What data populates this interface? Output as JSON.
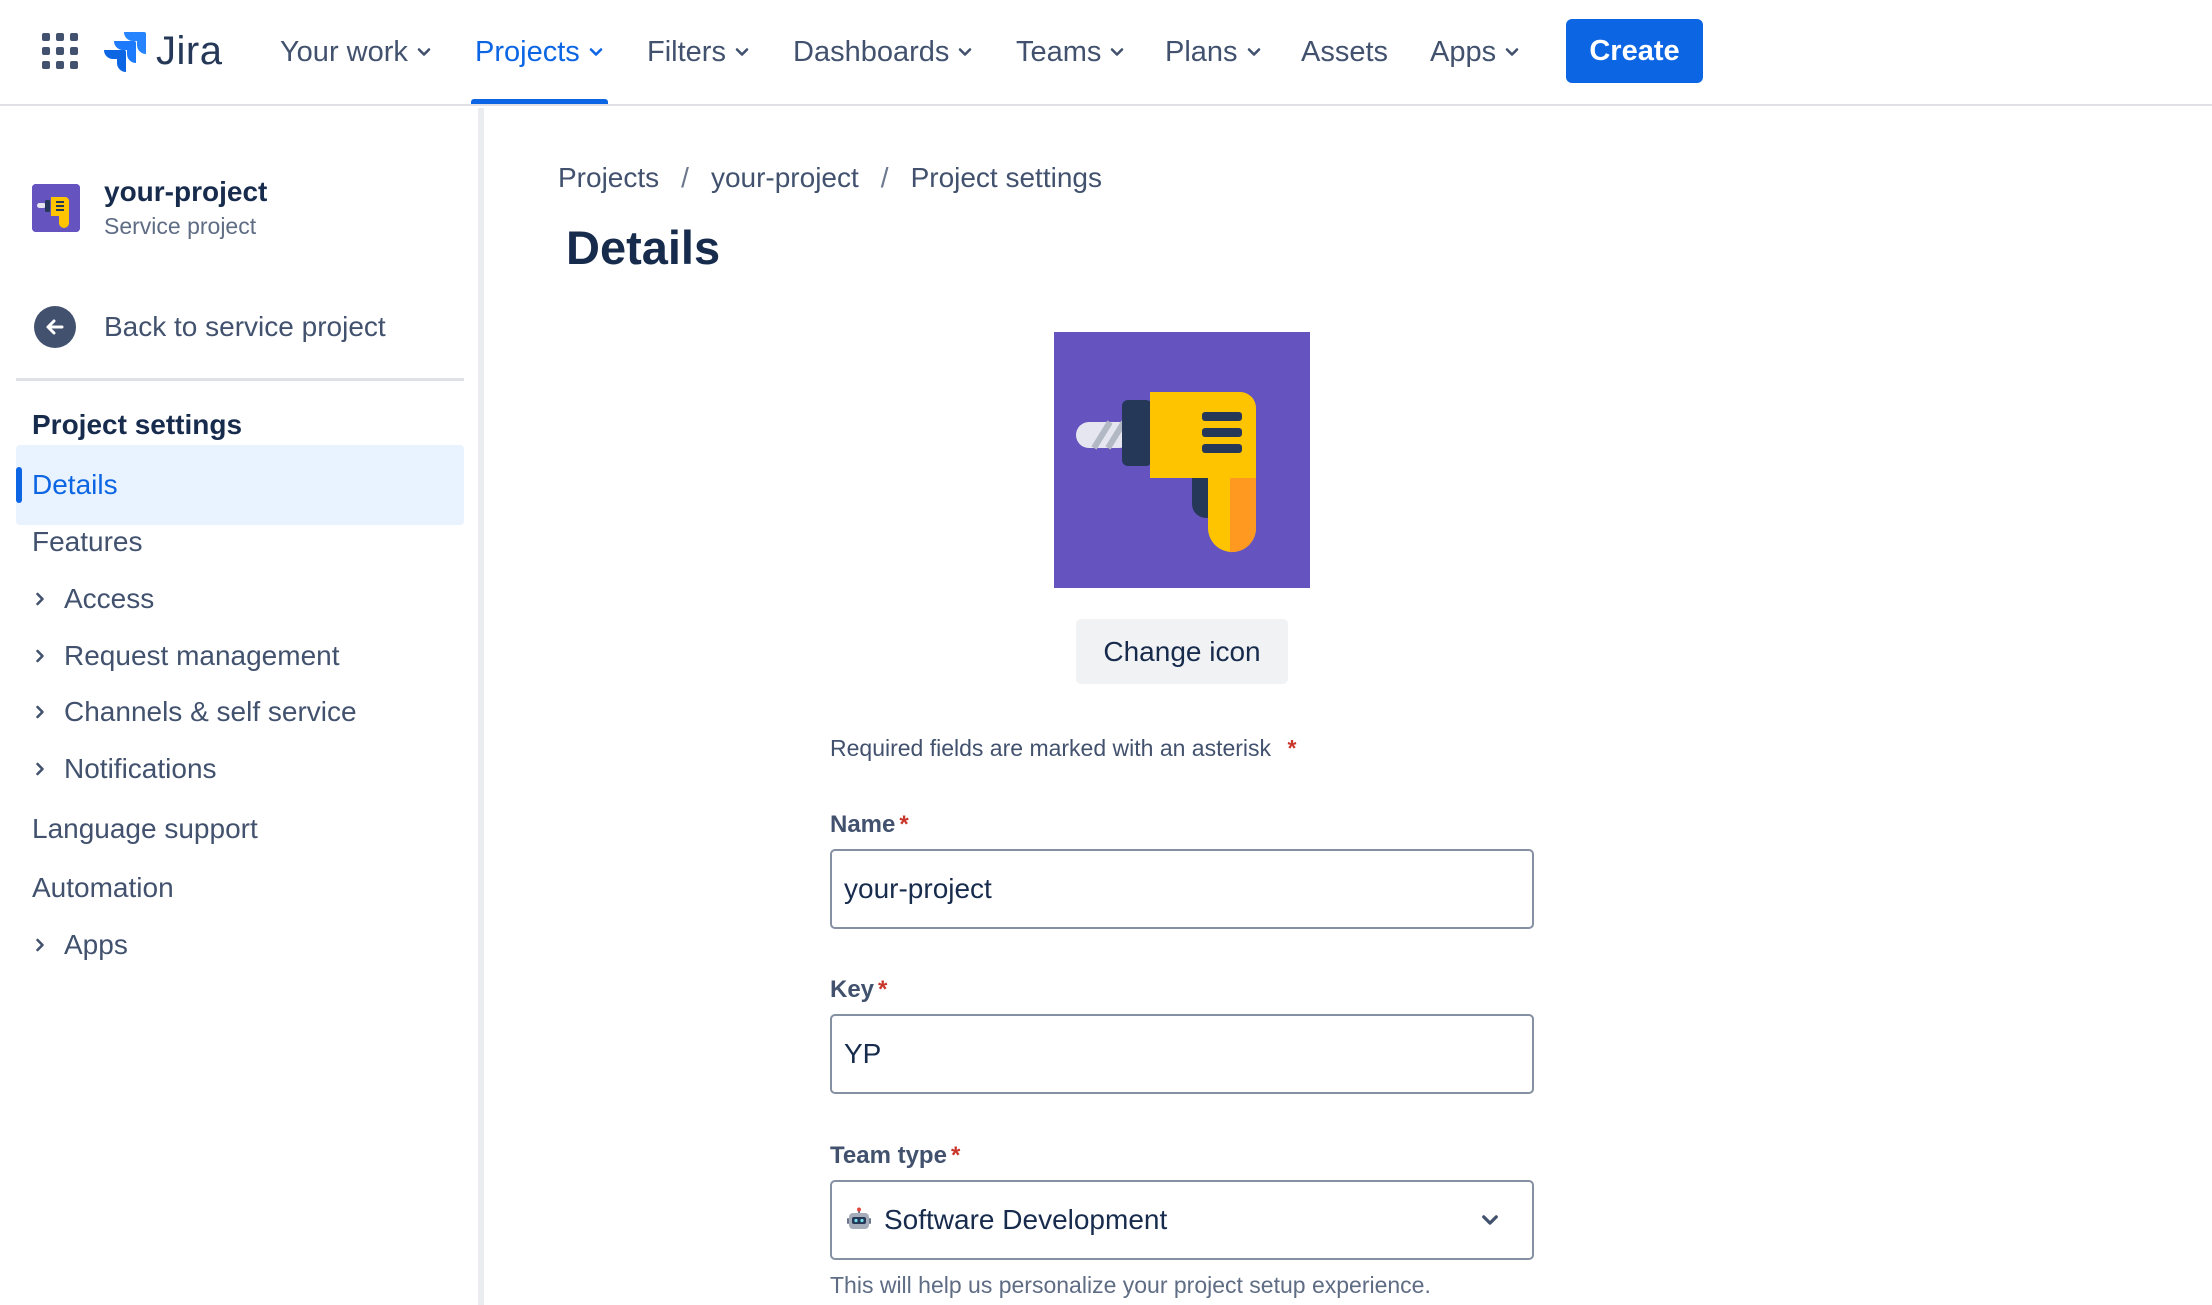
{
  "topnav": {
    "logo_text": "Jira",
    "items": [
      {
        "label": "Your work",
        "has_chevron": true
      },
      {
        "label": "Projects",
        "has_chevron": true,
        "active": true
      },
      {
        "label": "Filters",
        "has_chevron": true
      },
      {
        "label": "Dashboards",
        "has_chevron": true
      },
      {
        "label": "Teams",
        "has_chevron": true
      },
      {
        "label": "Plans",
        "has_chevron": true
      },
      {
        "label": "Assets",
        "has_chevron": false
      },
      {
        "label": "Apps",
        "has_chevron": true
      }
    ],
    "create_label": "Create"
  },
  "sidebar": {
    "project_name": "your-project",
    "project_type": "Service project",
    "back_label": "Back to service project",
    "section_title": "Project settings",
    "items": [
      {
        "label": "Details",
        "expandable": false,
        "selected": true
      },
      {
        "label": "Features",
        "expandable": false
      },
      {
        "label": "Access",
        "expandable": true
      },
      {
        "label": "Request management",
        "expandable": true
      },
      {
        "label": "Channels & self service",
        "expandable": true
      },
      {
        "label": "Notifications",
        "expandable": true
      },
      {
        "label": "Language support",
        "expandable": false
      },
      {
        "label": "Automation",
        "expandable": false
      },
      {
        "label": "Apps",
        "expandable": true
      }
    ]
  },
  "main": {
    "breadcrumb": [
      "Projects",
      "your-project",
      "Project settings"
    ],
    "breadcrumb_separator": "/",
    "title": "Details",
    "change_icon_label": "Change icon",
    "required_note": "Required fields are marked with an asterisk",
    "asterisk": "*",
    "fields": {
      "name": {
        "label": "Name",
        "value": "your-project"
      },
      "key": {
        "label": "Key",
        "value": "YP"
      },
      "team_type": {
        "label": "Team type",
        "value": "Software Development",
        "icon": "robot-icon"
      }
    },
    "helper_text": "This will help us personalize your project setup experience."
  },
  "colors": {
    "brand_blue": "#0C66E4",
    "project_purple": "#6554C0",
    "drill_yellow": "#FFC400",
    "drill_orange": "#FF991F",
    "required_red": "#C9372C"
  }
}
